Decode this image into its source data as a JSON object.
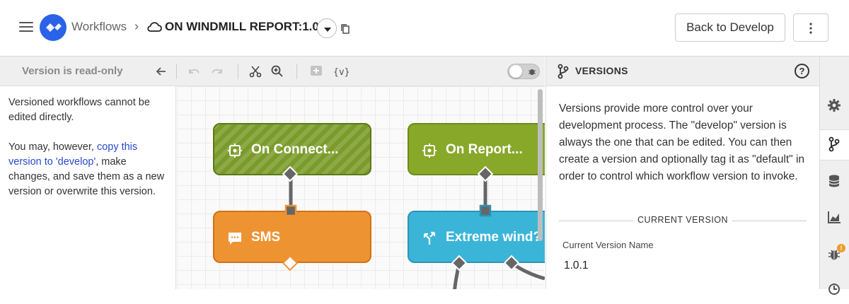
{
  "header": {
    "breadcrumb_root": "Workflows",
    "separator": "›",
    "workflow_title": "ON WINDMILL REPORT:1.0.1",
    "back_button": "Back to Develop"
  },
  "toolbar": {
    "readonly_label": "Version is read-only",
    "icons": [
      "arrow-left-icon",
      "undo-icon",
      "redo-icon",
      "scissors-icon",
      "zoom-icon",
      "add-node-icon",
      "variables-icon",
      "debug-toggle"
    ]
  },
  "left_panel": {
    "line1": "Versioned workflows cannot be edited directly.",
    "line2_before": "You may, however, ",
    "line2_link": "copy this version to 'develop'",
    "line2_after": ", make changes, and save them as a new version or overwrite this version."
  },
  "canvas": {
    "nodes": [
      {
        "label": "On Connect...",
        "color": "#7a9b2a",
        "icon": "trigger-icon"
      },
      {
        "label": "On Report...",
        "color": "#88a82a",
        "icon": "trigger-icon"
      },
      {
        "label": "SMS",
        "color": "#ee9332",
        "icon": "sms-icon"
      },
      {
        "label": "Extreme wind?",
        "color": "#3ab5d8",
        "icon": "conditional-icon"
      }
    ]
  },
  "versions_panel": {
    "title": "VERSIONS",
    "help": "?",
    "description": "Versions provide more control over your development process. The \"develop\" version is always the one that can be edited. You can then create a version and optionally tag it as \"default\" in order to control which workflow version to invoke.",
    "section_label": "CURRENT VERSION",
    "field_label": "Current Version Name",
    "field_value": "1.0.1"
  },
  "rail": {
    "items": [
      "settings-icon",
      "versions-icon",
      "storage-icon",
      "stats-icon",
      "debug-icon"
    ],
    "debug_badge": "!"
  },
  "colors": {
    "accent": "#2a63e8",
    "link": "#2749c9",
    "trigger": "#7a9b2a",
    "sms": "#ee9332",
    "conditional": "#3ab5d8"
  }
}
